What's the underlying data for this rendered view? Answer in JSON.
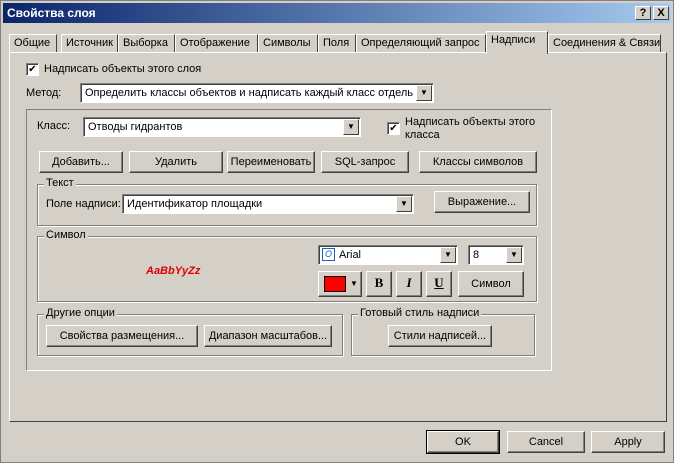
{
  "window": {
    "title": "Свойства слоя",
    "help_button": "?",
    "close_button": "X"
  },
  "tabs": [
    "Общие",
    "Источник",
    "Выборка",
    "Отображение",
    "Символы",
    "Поля",
    "Определяющий запрос",
    "Надписи",
    "Соединения & Связи"
  ],
  "active_tab": "Надписи",
  "label_layer": {
    "checkbox_label": "Надписать объекты этого слоя",
    "checked": true
  },
  "method": {
    "label": "Метод:",
    "value": "Определить классы объектов и надписать каждый класс отдельно"
  },
  "class_group": {
    "class_label": "Класс:",
    "class_value": "Отводы гидрантов",
    "class_checkbox_label_line1": "Надписать объекты этого",
    "class_checkbox_label_line2": "класса",
    "class_checked": true,
    "buttons": {
      "add": "Добавить...",
      "delete": "Удалить",
      "rename": "Переименовать",
      "sql": "SQL-запрос",
      "symbol_classes": "Классы символов"
    }
  },
  "text_group": {
    "legend": "Текст",
    "field_label": "Поле надписи:",
    "field_value": "Идентификатор площадки",
    "expression_button": "Выражение..."
  },
  "symbol_group": {
    "legend": "Символ",
    "sample_text": "AaBbYyZz",
    "font_name": "Arial",
    "font_size": "8",
    "color": "#ff0000",
    "bold": "B",
    "italic": "I",
    "underline": "U",
    "symbol_button": "Символ"
  },
  "other_options": {
    "legend": "Другие опции",
    "placement_button": "Свойства размещения...",
    "scale_button": "Диапазон масштабов..."
  },
  "label_style": {
    "legend": "Готовый стиль надписи",
    "styles_button": "Стили надписей..."
  },
  "footer": {
    "ok": "OK",
    "cancel": "Cancel",
    "apply": "Apply"
  }
}
